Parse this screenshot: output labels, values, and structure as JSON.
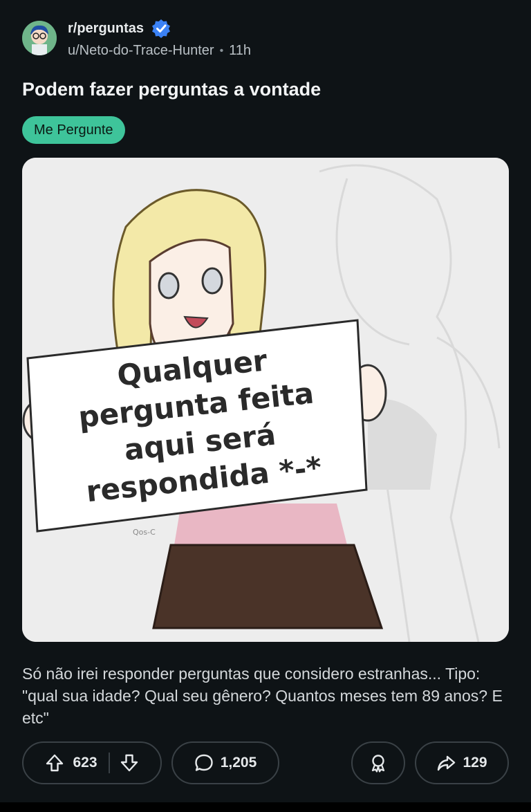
{
  "post": {
    "subreddit": "r/perguntas",
    "author": "u/Neto-do-Trace-Hunter",
    "separator": "•",
    "age": "11h",
    "title": "Podem fazer perguntas a vontade",
    "flair": "Me Pergunte",
    "image": {
      "sign_lines": [
        "Qualquer",
        "pergunta feita",
        "aqui será",
        "respondida *-*"
      ],
      "signature": "Qos-C"
    },
    "body": "Só não irei responder perguntas que considero estranhas... Tipo: \"qual sua idade? Qual seu gênero? Quantos meses tem 89 anos? E etc\""
  },
  "actions": {
    "upvotes": "623",
    "comments": "1,205",
    "shares": "129"
  },
  "icons": {
    "verified": "verified-badge-icon",
    "upvote": "arrow-up-icon",
    "downvote": "arrow-down-icon",
    "comment": "comment-bubble-icon",
    "award": "award-icon",
    "share": "share-arrow-icon"
  },
  "colors": {
    "background": "#0e1316",
    "flair": "#3ec49a",
    "verified": "#3b82f6"
  }
}
